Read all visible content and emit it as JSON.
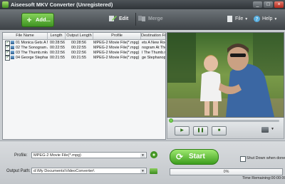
{
  "window": {
    "title": "Aiseesoft MKV Converter (Unregistered)",
    "minimize": "_",
    "maximize": "□",
    "close": "×"
  },
  "toolbar": {
    "add_label": "Add...",
    "edit_label": "Edit",
    "merge_label": "Merge",
    "file_menu": "File",
    "help_menu": "Help"
  },
  "file_list": {
    "columns": [
      "File Name",
      "Length",
      "Output Length",
      "Profile",
      "Destination File"
    ],
    "rows": [
      {
        "name": "01 Monica Gets A Ne",
        "length": "00:28:56",
        "output_length": "00:28:56",
        "profile": "MPEG-2 Movie File(*.mpg)",
        "destination": "ets A New Roor"
      },
      {
        "name": "02 The Sonogram At",
        "length": "00:22:55",
        "output_length": "00:22:55",
        "profile": "MPEG-2 Movie File(*.mpg)",
        "destination": "nogram At The"
      },
      {
        "name": "03 The Thumb.mkv",
        "length": "00:22:56",
        "output_length": "00:22:56",
        "profile": "MPEG-2 Movie File(*.mpg)",
        "destination": "l The Thumb.mp"
      },
      {
        "name": "04 George Stephano",
        "length": "00:21:55",
        "output_length": "00:21:55",
        "profile": "MPEG-2 Movie File(*.mpg)",
        "destination": "ge Stephanopoul"
      }
    ]
  },
  "player": {
    "seek_fraction": 0.0
  },
  "bottom": {
    "profile_label": "Profile:",
    "profile_value": "MPEG-2 Movie File(*.mpg)",
    "output_label": "Output Path:",
    "output_value": "d:\\My Documents\\VideoConverter\\",
    "start_label": "Start",
    "shutdown_label": "Shut Down when done",
    "progress_text": "0%",
    "progress_fraction": 0.0,
    "time_remaining": "Time Remaining:00:00:00"
  },
  "colors": {
    "accent_green": "#3d9d1e",
    "toolbar_dark": "#3d4246"
  }
}
